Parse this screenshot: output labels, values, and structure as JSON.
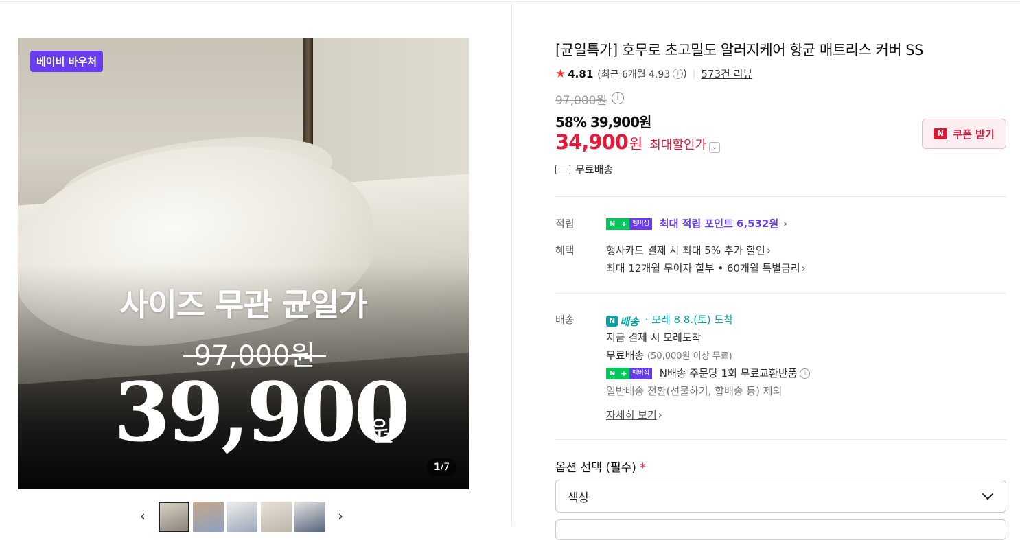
{
  "product": {
    "voucher_badge": "베이비 바우처",
    "hero_title": "사이즈 무관 균일가",
    "hero_old_price": "97,000원",
    "hero_price": "39,900",
    "hero_won": "원",
    "image_counter_current": "1",
    "image_counter_total": "/7",
    "title": "[균일특가] 호무로 초고밀도 알러지케어 항균 매트리스 커버 SS",
    "rating": "4.81",
    "recent_rating": "(최근 6개월 4.93",
    "recent_rating_close": ")",
    "review_count": "573건 리뷰",
    "original_price": "97,000원",
    "discount_line": "58% 39,900원",
    "max_discount_price": "34,900",
    "max_discount_unit": "원",
    "max_discount_label": "최대할인가",
    "coupon_label": "쿠폰 받기",
    "shipping_fee": "무료배송"
  },
  "benefits": {
    "points_label": "적립",
    "points_text": "최대 적립 포인트 6,532원",
    "benefit_label": "혜택",
    "benefit_line1": "행사카드 결제 시 최대 5% 추가 할인",
    "benefit_line2": "최대 12개월 무이자 할부 • 60개월 특별금리",
    "membership_text": "멤버십"
  },
  "delivery": {
    "label": "배송",
    "n_delivery": "배송",
    "arrival": "· 모레 8.8.(토) 도착",
    "line1": "지금 결제 시 모레도착",
    "line2_main": "무료배송",
    "line2_sub": "(50,000원 이상 무료)",
    "line3": "N배송 주문당 1회 무료교환반품",
    "line4": "일반배송 전환(선물하기, 합배송 등) 제외",
    "details_link": "자세히 보기"
  },
  "options": {
    "label": "옵션 선택 (필수)",
    "required_mark": "*",
    "first_select": "색상"
  },
  "colors": {
    "accent_red": "#e31b3a",
    "purple": "#6a3cf0",
    "naver_green": "#03c75a",
    "delivery_teal": "#03a6a6"
  }
}
